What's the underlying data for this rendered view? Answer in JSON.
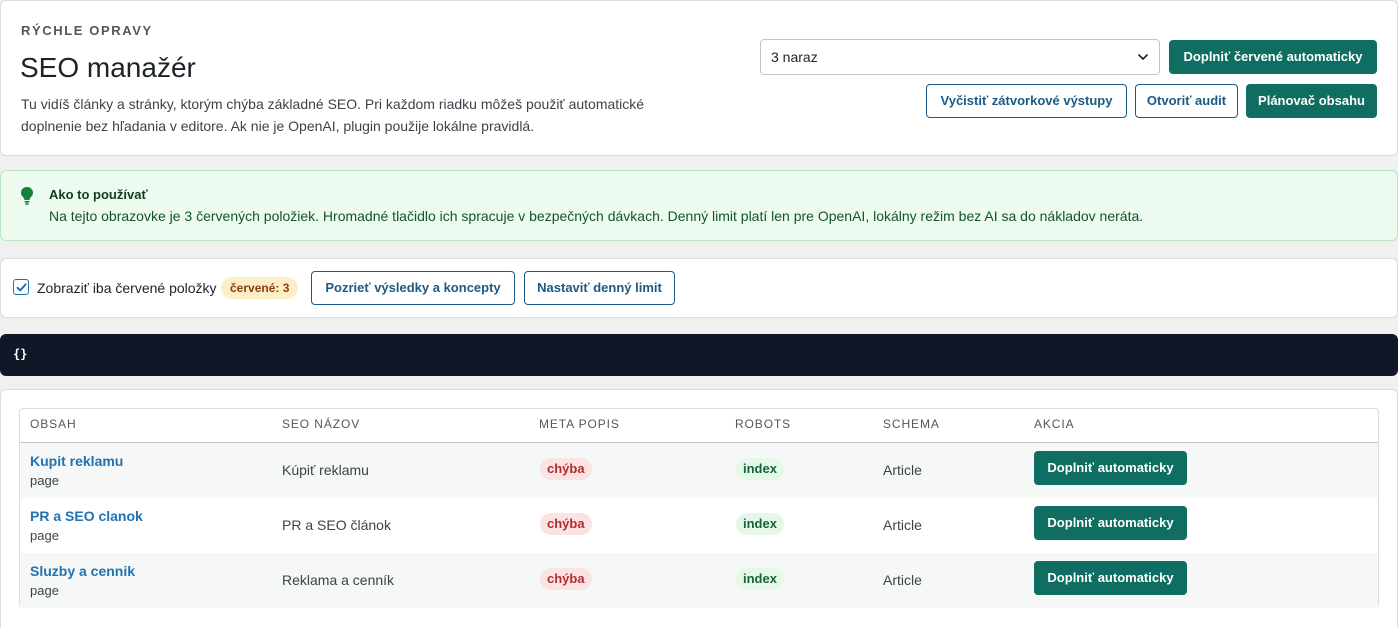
{
  "header": {
    "eyebrow": "RÝCHLE OPRAVY",
    "title": "SEO manažér",
    "description": "Tu vidíš články a stránky, ktorým chýba základné SEO. Pri každom riadku môžeš použiť automatické doplnenie bez hľadania v editore. Ak nie je OpenAI, plugin použije lokálne pravidlá.",
    "batch_select_value": "3 naraz",
    "fill_red_button": "Doplniť červené automaticky",
    "clear_brackets_button": "Vyčistiť zátvorkové výstupy",
    "open_audit_button": "Otvoriť audit",
    "planner_button": "Plánovač obsahu"
  },
  "notice": {
    "title": "Ako to používať",
    "text": "Na tejto obrazovke je 3 červených položiek. Hromadné tlačidlo ich spracuje v bezpečných dávkach. Denný limit platí len pre OpenAI, lokálny režim bez AI sa do nákladov neráta."
  },
  "filter": {
    "checkbox_label": "Zobraziť iba červené položky",
    "checkbox_checked": true,
    "red_count_badge": "červené: 3",
    "results_button": "Pozrieť výsledky a koncepty",
    "limit_button": "Nastaviť denný limit"
  },
  "debug": {
    "text": "{}"
  },
  "table": {
    "columns": [
      "OBSAH",
      "SEO NÁZOV",
      "META POPIS",
      "ROBOTS",
      "SCHEMA",
      "AKCIA"
    ],
    "rows": [
      {
        "title": "Kupit reklamu",
        "type": "page",
        "seo_title": "Kúpiť reklamu",
        "meta": "chýba",
        "robots": "index",
        "schema": "Article",
        "action": "Doplniť automaticky"
      },
      {
        "title": "PR a SEO clanok",
        "type": "page",
        "seo_title": "PR a SEO článok",
        "meta": "chýba",
        "robots": "index",
        "schema": "Article",
        "action": "Doplniť automaticky"
      },
      {
        "title": "Sluzby a cennik",
        "type": "page",
        "seo_title": "Reklama a cenník",
        "meta": "chýba",
        "robots": "index",
        "schema": "Article",
        "action": "Doplniť automaticky"
      }
    ]
  },
  "colors": {
    "primary": "#0f6e61",
    "link": "#2271b1",
    "error_pill": "#b32d2e",
    "ok_pill": "#17633a",
    "notice_bg": "#edfaef"
  }
}
